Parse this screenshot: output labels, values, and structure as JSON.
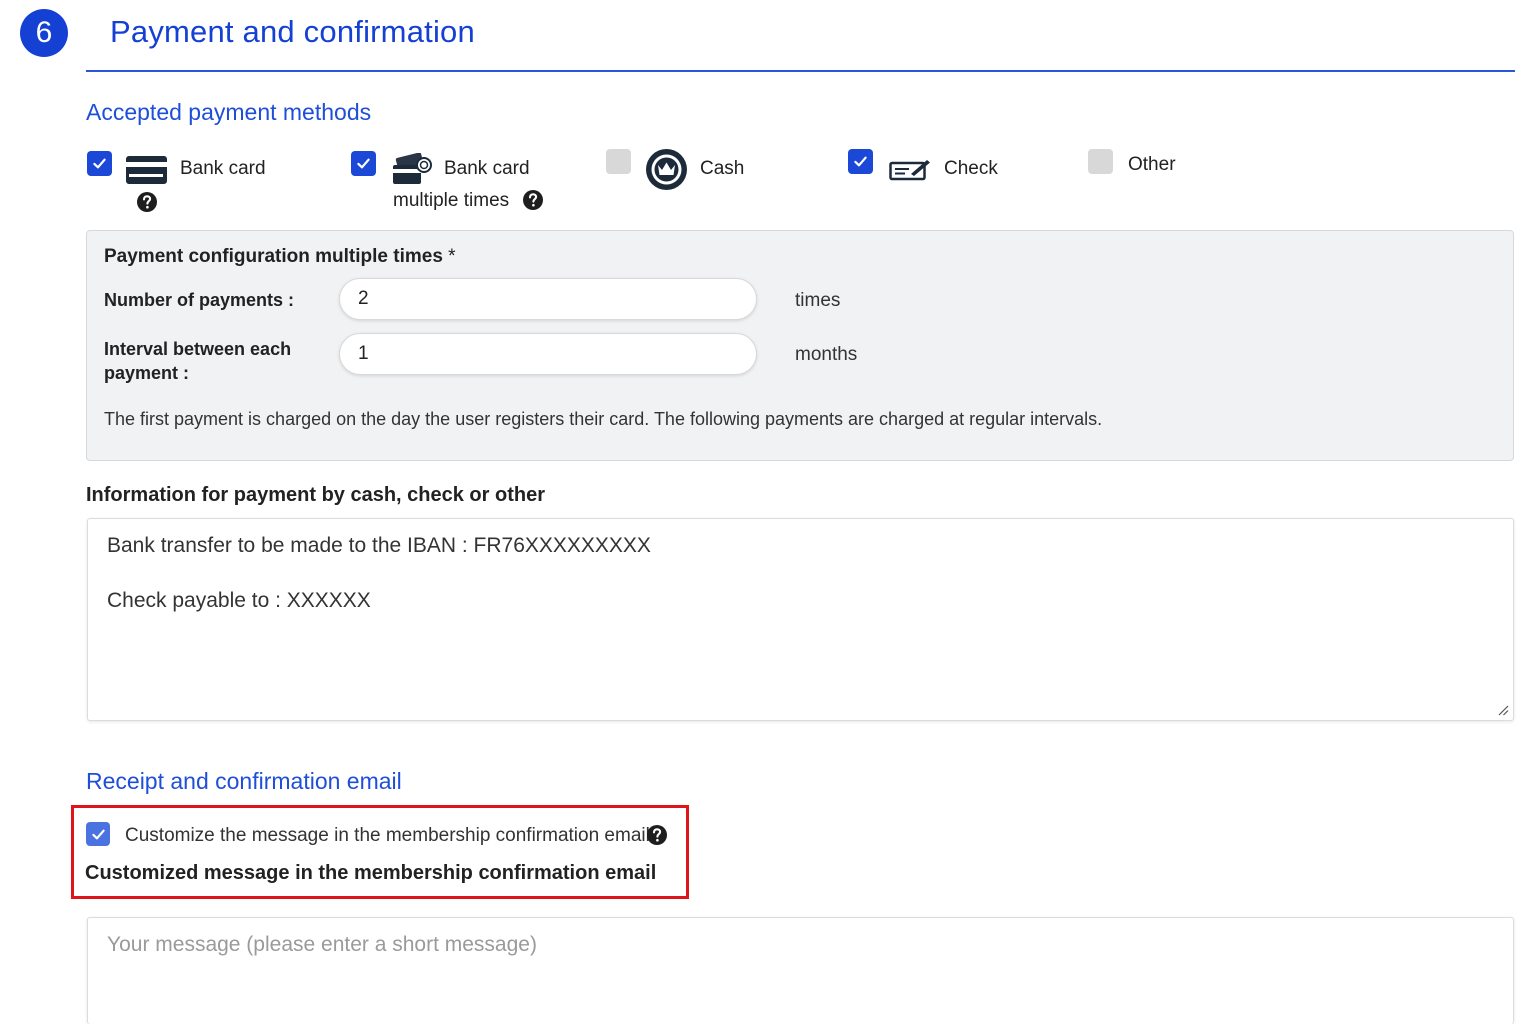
{
  "step": {
    "number": "6",
    "title": "Payment and confirmation"
  },
  "payment_methods": {
    "section_title": "Accepted payment methods",
    "items": [
      {
        "label": "Bank card",
        "checked": true,
        "icon": "credit-card-icon",
        "has_help": true
      },
      {
        "label": "Bank card",
        "label_line2": "multiple times",
        "checked": true,
        "icon": "cards-coin-icon",
        "has_help": true
      },
      {
        "label": "Cash",
        "checked": false,
        "icon": "crown-coin-icon",
        "has_help": false
      },
      {
        "label": "Check",
        "checked": true,
        "icon": "check-cheque-icon",
        "has_help": false
      },
      {
        "label": "Other",
        "checked": false,
        "icon": "",
        "has_help": false
      }
    ]
  },
  "config": {
    "title": "Payment configuration multiple times",
    "required_mark": "*",
    "number_label": "Number of payments :",
    "number_value": "2",
    "number_unit": "times",
    "interval_label_line1": "Interval between each",
    "interval_label_line2": "payment :",
    "interval_value": "1",
    "interval_unit": "months",
    "note": "The first payment is charged on the day the user registers their card. The following payments are charged at regular intervals."
  },
  "payment_info": {
    "label": "Information for payment by cash, check or other",
    "line1": "Bank transfer to be made to the IBAN : FR76XXXXXXXXX",
    "line2": "Check payable to : XXXXXX"
  },
  "receipt": {
    "section_title": "Receipt and confirmation email",
    "customize_label": "Customize the message in the membership confirmation email",
    "customize_checked": true,
    "message_label": "Customized message in the membership confirmation email",
    "message_placeholder": "Your message (please enter a short message)"
  },
  "colors": {
    "accent": "#1540d4",
    "highlight": "#e0141b",
    "panel_bg": "#f1f2f4"
  }
}
